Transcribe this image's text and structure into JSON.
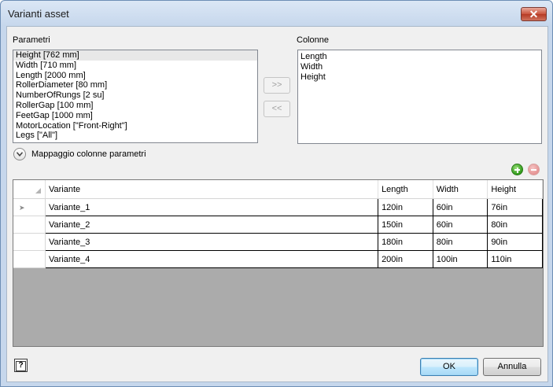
{
  "window": {
    "title": "Varianti asset",
    "close_glyph": "✕"
  },
  "parameters": {
    "label": "Parametri",
    "items": [
      "Height [762 mm]",
      "Width [710 mm]",
      "Length [2000 mm]",
      "RollerDiameter [80 mm]",
      "NumberOfRungs [2 su]",
      "RollerGap [100 mm]",
      "FeetGap [1000 mm]",
      "MotorLocation [\"Front-Right\"]",
      "Legs [\"All\"]"
    ]
  },
  "columns": {
    "label": "Colonne",
    "items": [
      "Length",
      "Width",
      "Height"
    ]
  },
  "move_buttons": {
    "add": ">>",
    "remove": "<<"
  },
  "mapping_expander": {
    "label": "Mappaggio colonne parametri"
  },
  "grid": {
    "headers": [
      "Variante",
      "Length",
      "Width",
      "Height"
    ],
    "current_row_glyph": "➤",
    "rows": [
      [
        "Variante_1",
        "120in",
        "60in",
        "76in"
      ],
      [
        "Variante_2",
        "150in",
        "60in",
        "80in"
      ],
      [
        "Variante_3",
        "180in",
        "80in",
        "90in"
      ],
      [
        "Variante_4",
        "200in",
        "100in",
        "110in"
      ]
    ]
  },
  "footer": {
    "help_glyph": "?",
    "ok_label": "OK",
    "cancel_label": "Annulla"
  },
  "icons": {
    "add_row": "plus-circle-icon",
    "remove_row": "minus-circle-icon",
    "expand": "chevron-down-icon"
  }
}
